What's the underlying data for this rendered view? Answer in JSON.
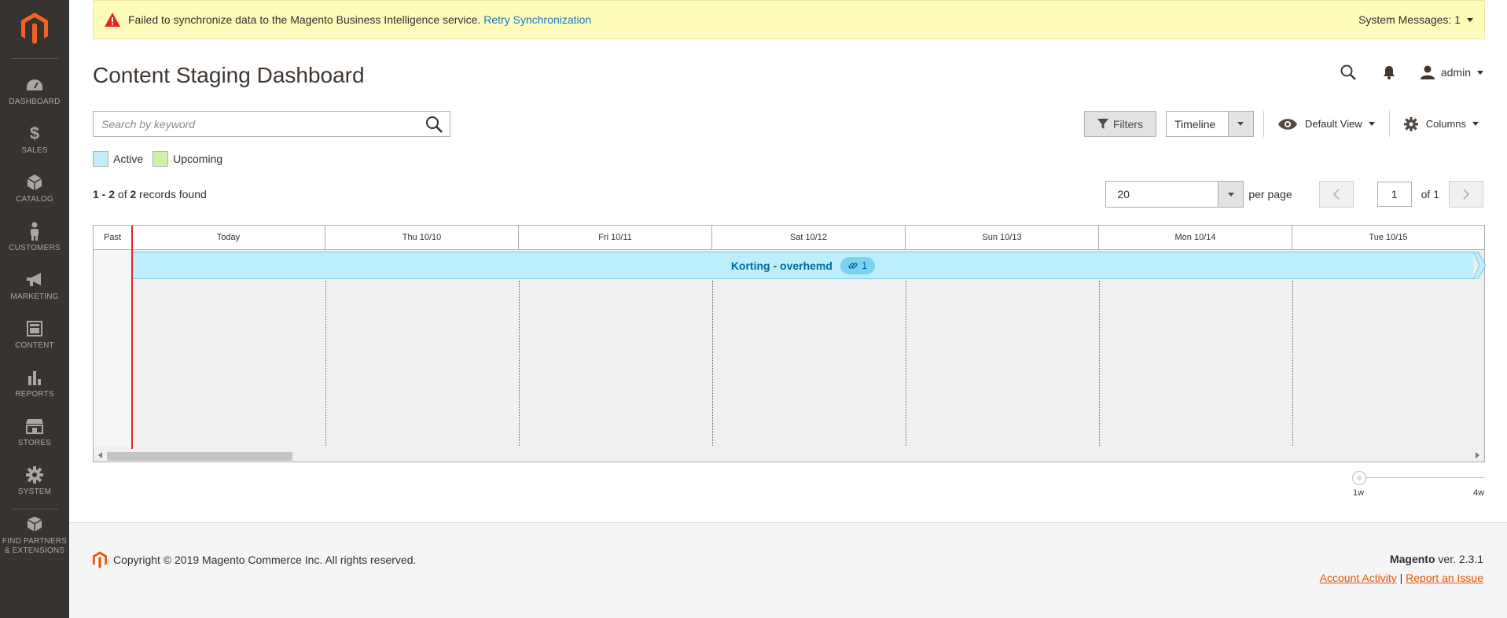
{
  "sidebar": {
    "logo_icon": "magento-logo-icon",
    "items": [
      {
        "label": "Dashboard",
        "icon": "dashboard-icon"
      },
      {
        "label": "Sales",
        "icon": "dollar-icon"
      },
      {
        "label": "Catalog",
        "icon": "box-icon"
      },
      {
        "label": "Customers",
        "icon": "person-icon"
      },
      {
        "label": "Marketing",
        "icon": "megaphone-icon"
      },
      {
        "label": "Content",
        "icon": "layout-icon"
      },
      {
        "label": "Reports",
        "icon": "bar-chart-icon"
      },
      {
        "label": "Stores",
        "icon": "store-icon"
      },
      {
        "label": "System",
        "icon": "gear-icon"
      },
      {
        "label": "Find Partners",
        "label2": "& Extensions",
        "icon": "cubes-icon"
      }
    ]
  },
  "system_message": {
    "text": "Failed to synchronize data to the Magento Business Intelligence service.",
    "link": "Retry Synchronization",
    "messages_label": "System Messages: 1"
  },
  "header": {
    "title": "Content Staging Dashboard",
    "user": "admin"
  },
  "search": {
    "placeholder": "Search by keyword"
  },
  "legend": {
    "active": "Active",
    "upcoming": "Upcoming",
    "active_color": "#c3ecfb",
    "upcoming_color": "#d0f0a4"
  },
  "toolbar": {
    "filters": "Filters",
    "view_mode": "Timeline",
    "default_view": "Default View",
    "columns": "Columns"
  },
  "records": {
    "range": "1 - 2",
    "of": "of",
    "total": "2",
    "suffix": "records found"
  },
  "pager": {
    "per_page_value": "20",
    "per_page_label": "per page",
    "current_page": "1",
    "of_pages": "of 1"
  },
  "timeline": {
    "past_label": "Past",
    "columns": [
      "Today",
      "Thu 10/10",
      "Fri 10/11",
      "Sat 10/12",
      "Sun 10/13",
      "Mon 10/14",
      "Tue 10/15"
    ],
    "event": {
      "name": "Korting - overhemd",
      "count": "1"
    },
    "zoom_min": "1w",
    "zoom_max": "4w",
    "zoom_level": 0
  },
  "footer": {
    "copyright": "Copyright © 2019 Magento Commerce Inc. All rights reserved.",
    "brand": "Magento",
    "version": "ver. 2.3.1",
    "account_activity": "Account Activity",
    "separator": "|",
    "report_issue": "Report an Issue"
  }
}
